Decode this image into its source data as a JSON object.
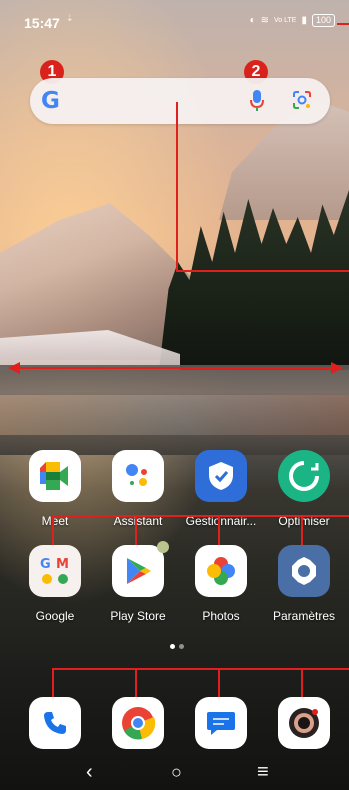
{
  "status_bar": {
    "time": "15:47",
    "network_label": "Vo LTE",
    "battery": "100"
  },
  "callouts": {
    "badge_1": "1",
    "badge_2": "2"
  },
  "search_bar": {
    "logo": "G"
  },
  "apps_row1": [
    {
      "label": "Meet",
      "icon": "meet-icon"
    },
    {
      "label": "Assistant",
      "icon": "assistant-icon"
    },
    {
      "label": "Gestionnair...",
      "icon": "phone-manager-icon"
    },
    {
      "label": "Optimiser",
      "icon": "optimiser-icon"
    }
  ],
  "apps_row2": [
    {
      "label": "Google",
      "icon": "google-folder-icon"
    },
    {
      "label": "Play Store",
      "icon": "play-store-icon"
    },
    {
      "label": "Photos",
      "icon": "photos-icon"
    },
    {
      "label": "Paramètres",
      "icon": "settings-icon"
    }
  ],
  "dock": [
    {
      "icon": "phone-icon"
    },
    {
      "icon": "chrome-icon"
    },
    {
      "icon": "messages-icon"
    },
    {
      "icon": "camera-icon"
    }
  ],
  "nav": {
    "back": "‹",
    "home": "○",
    "recents": "≡"
  },
  "colors": {
    "callout_red": "#e0201c",
    "badge_red": "#d9221c"
  }
}
